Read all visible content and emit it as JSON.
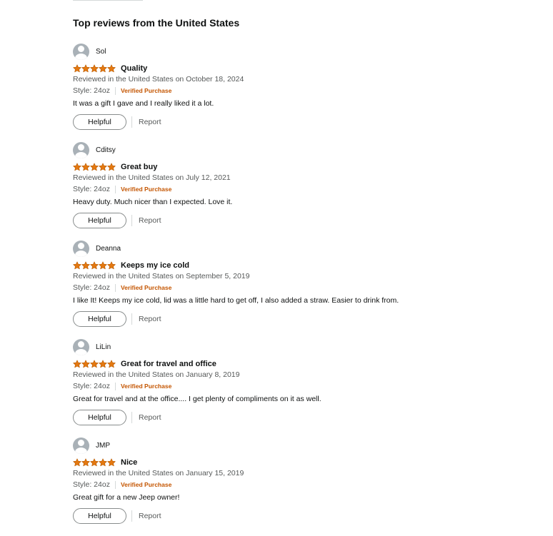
{
  "section_title": "Top reviews from the United States",
  "colors": {
    "star": "#e47911",
    "verified": "#c45500",
    "avatar": "#a9b1b7"
  },
  "reviews": [
    {
      "profile_name": "Sol",
      "rating": 5,
      "title": "Quality",
      "date": "Reviewed in the United States on October 18, 2024",
      "style": "Style: 24oz",
      "verified": "Verified Purchase",
      "body": "It was a gift I gave and I really liked it a lot.",
      "helpful_label": "Helpful",
      "report_label": "Report"
    },
    {
      "profile_name": "Cditsy",
      "rating": 5,
      "title": "Great buy",
      "date": "Reviewed in the United States on July 12, 2021",
      "style": "Style: 24oz",
      "verified": "Verified Purchase",
      "body": "Heavy duty. Much nicer than I expected. Love it.",
      "helpful_label": "Helpful",
      "report_label": "Report"
    },
    {
      "profile_name": "Deanna",
      "rating": 5,
      "title": "Keeps my ice cold",
      "date": "Reviewed in the United States on September 5, 2019",
      "style": "Style: 24oz",
      "verified": "Verified Purchase",
      "body": "I like It! Keeps my ice cold, lid was a little hard to get off, I also added a straw. Easier to drink from.",
      "helpful_label": "Helpful",
      "report_label": "Report"
    },
    {
      "profile_name": "LiLin",
      "rating": 5,
      "title": "Great for travel and office",
      "date": "Reviewed in the United States on January 8, 2019",
      "style": "Style: 24oz",
      "verified": "Verified Purchase",
      "body": "Great for travel and at the office.... I get plenty of compliments on it as well.",
      "helpful_label": "Helpful",
      "report_label": "Report"
    },
    {
      "profile_name": "JMP",
      "rating": 5,
      "title": "Nice",
      "date": "Reviewed in the United States on January 15, 2019",
      "style": "Style: 24oz",
      "verified": "Verified Purchase",
      "body": "Great gift for a new Jeep owner!",
      "helpful_label": "Helpful",
      "report_label": "Report"
    }
  ]
}
